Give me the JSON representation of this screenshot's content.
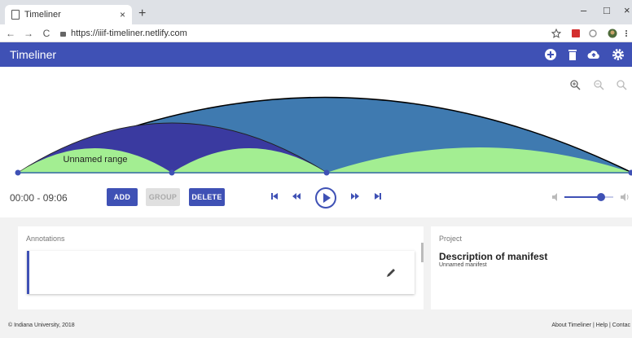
{
  "browser": {
    "tab_title": "Timeliner",
    "tab_close": "×",
    "new_tab": "+",
    "url": "https://iiif-timeliner.netlify.com",
    "back": "←",
    "forward": "→",
    "reload": "C",
    "minimize": "–",
    "maximize": "□",
    "close": "×"
  },
  "app": {
    "title": "Timeliner",
    "accent": "#3f51b5",
    "icons": [
      "add-circle-icon",
      "trash-icon",
      "cloud-upload-icon",
      "gear-icon"
    ]
  },
  "timeline": {
    "range_label": "Unnamed range",
    "colors": {
      "outer": "#3f7ab0",
      "purple": "#3a3aa0",
      "green": "#a3ee92"
    }
  },
  "controls": {
    "timecode": "00:00 - 09:06",
    "add_label": "ADD",
    "group_label": "GROUP",
    "delete_label": "DELETE",
    "volume_level": 0.75
  },
  "annotations": {
    "title": "Annotations"
  },
  "project": {
    "title": "Project",
    "description_title": "Description of manifest",
    "manifest_name": "Unnamed manifest"
  },
  "footer": {
    "copyright": "© Indiana University, 2018",
    "links": "About Timeliner | Help | Contac"
  }
}
